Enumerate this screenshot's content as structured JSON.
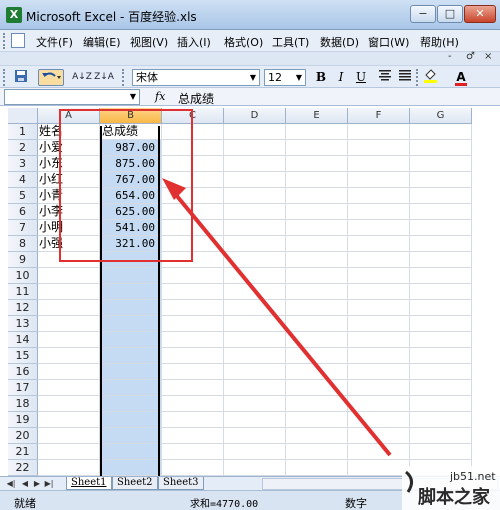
{
  "window": {
    "title": "Microsoft Excel - 百度经验.xls",
    "app_badge": "X",
    "minimize": "−",
    "maximize": "□",
    "close": "✕"
  },
  "menu": {
    "items": [
      "文件(F)",
      "编辑(E)",
      "视图(V)",
      "插入(I)",
      "格式(O)",
      "工具(T)",
      "数据(D)",
      "窗口(W)",
      "帮助(H)"
    ],
    "mdi_min": "-",
    "mdi_max": "♂",
    "mdi_close": "×"
  },
  "toolbar": {
    "font_name": "宋体",
    "font_size": "12",
    "bold": "B",
    "italic": "I",
    "underline": "U",
    "sort_asc": "A↓Z",
    "sort_desc": "Z↓A",
    "font_color_label": "A"
  },
  "formula_bar": {
    "fx": "fx",
    "content": "总成绩"
  },
  "columns": [
    "A",
    "B",
    "C",
    "D",
    "E",
    "F",
    "G"
  ],
  "selected_column": "B",
  "rows": [
    1,
    2,
    3,
    4,
    5,
    6,
    7,
    8,
    9,
    10,
    11,
    12,
    13,
    14,
    15,
    16,
    17,
    18,
    19,
    20,
    21,
    22
  ],
  "cells": {
    "a": [
      "姓名",
      "小爱",
      "小东",
      "小红",
      "小青",
      "小李",
      "小明",
      "小强"
    ],
    "b": [
      "总成绩",
      "987.00",
      "875.00",
      "767.00",
      "654.00",
      "625.00",
      "541.00",
      "321.00"
    ]
  },
  "sheets": [
    "Sheet1",
    "Sheet2",
    "Sheet3"
  ],
  "active_sheet": "Sheet1",
  "status": {
    "mode": "就绪",
    "sum": "求和=4770.00",
    "num": "数字"
  },
  "watermark": {
    "url": "jb51.net",
    "name": "脚本之家"
  },
  "colors": {
    "annotation_red": "#e03030",
    "selection_blue": "#c5dbf4",
    "header_highlight": "#f9b847"
  }
}
